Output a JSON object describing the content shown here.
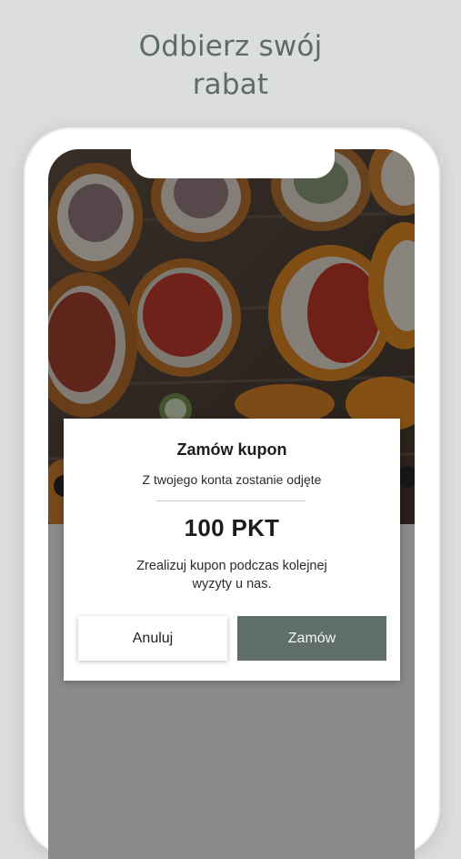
{
  "headline": {
    "line1": "Odbierz swój",
    "line2": "rabat"
  },
  "modal": {
    "title": "Zamów kupon",
    "subtitle": "Z twojego konta zostanie odjęte",
    "points": "100 PKT",
    "note": "Zrealizuj kupon podczas kolejnej wyzyty u nas.",
    "cancel_label": "Anuluj",
    "order_label": "Zamów"
  },
  "colors": {
    "accent": "#5f6e66",
    "headline": "#5f6c66",
    "background": "#dcdddd",
    "overlay_gray": "#8b8b8b"
  }
}
